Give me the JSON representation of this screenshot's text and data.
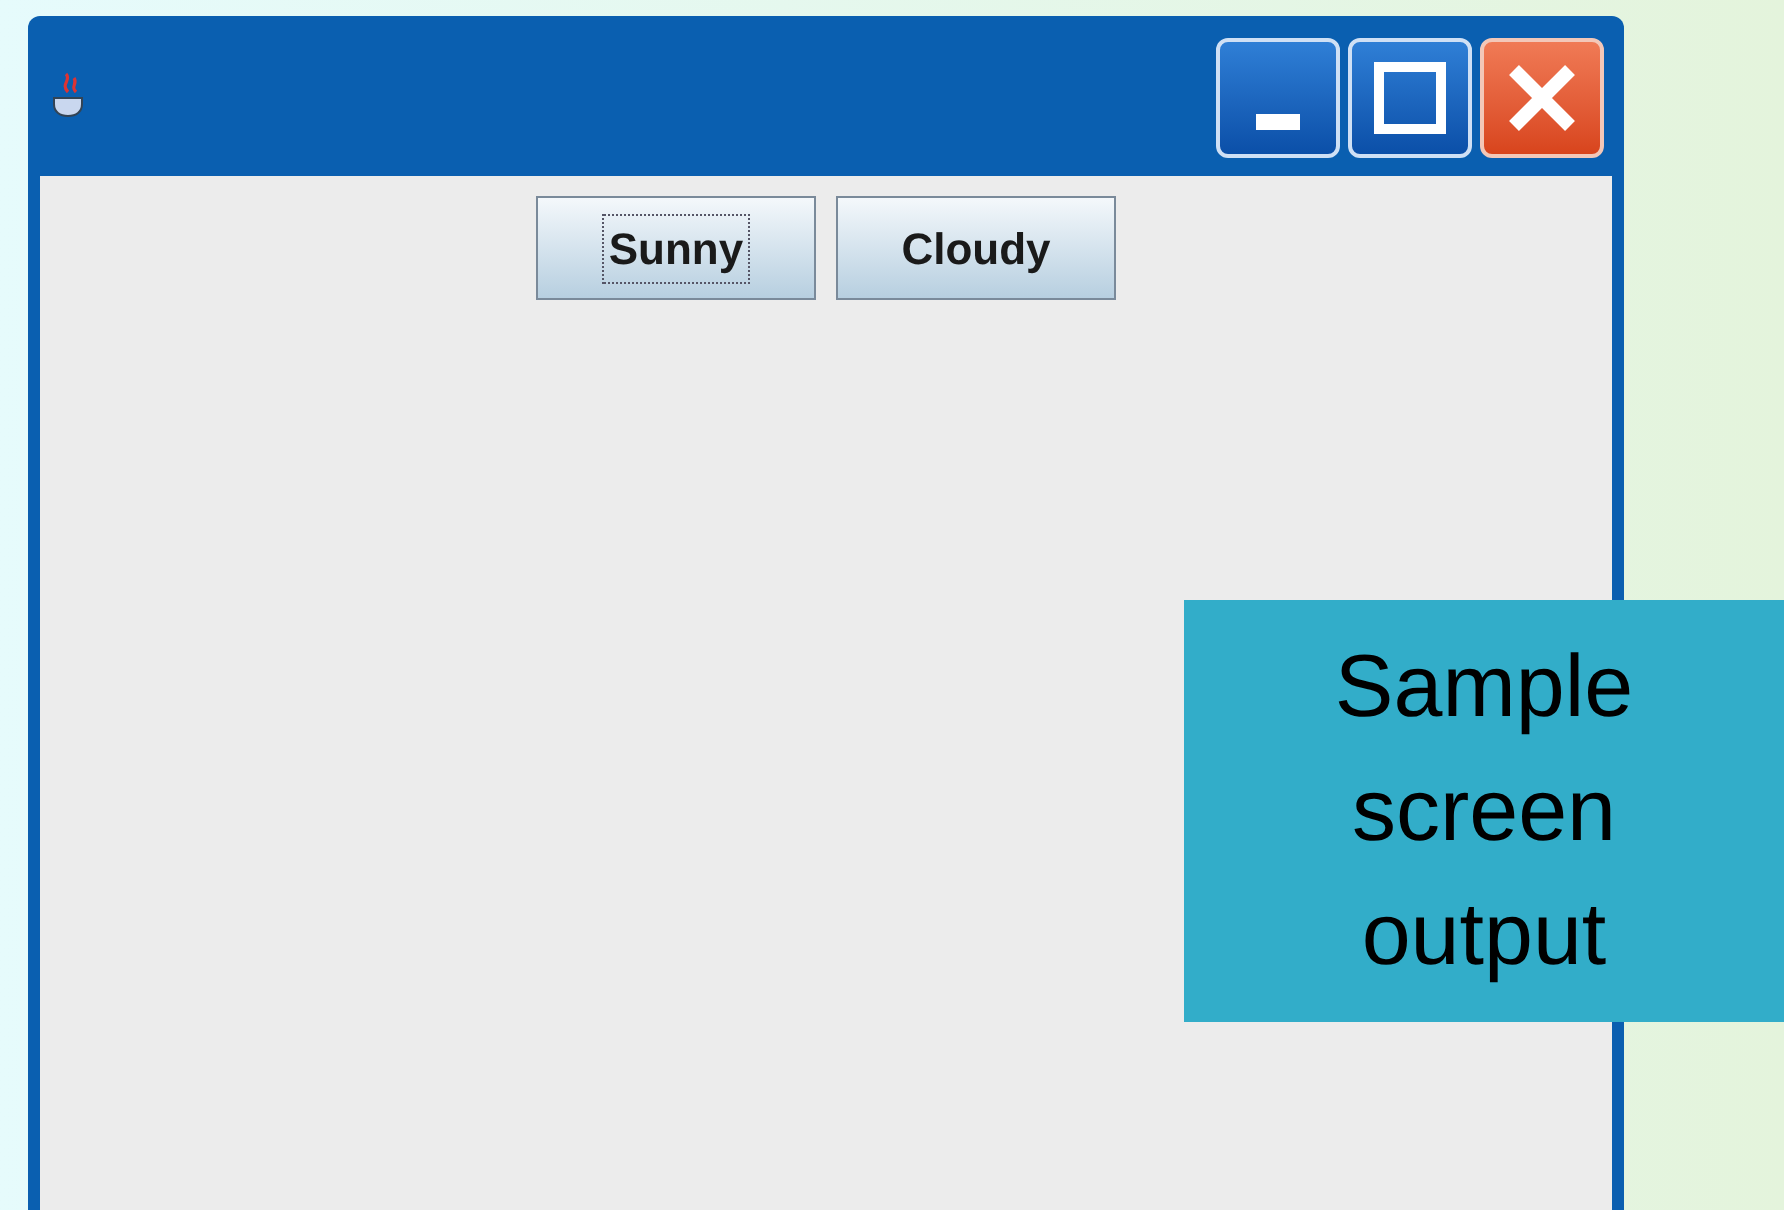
{
  "window": {
    "buttons": [
      {
        "label": "Sunny",
        "focused": true
      },
      {
        "label": "Cloudy",
        "focused": false
      }
    ]
  },
  "callout": {
    "text": "Sample screen output"
  }
}
